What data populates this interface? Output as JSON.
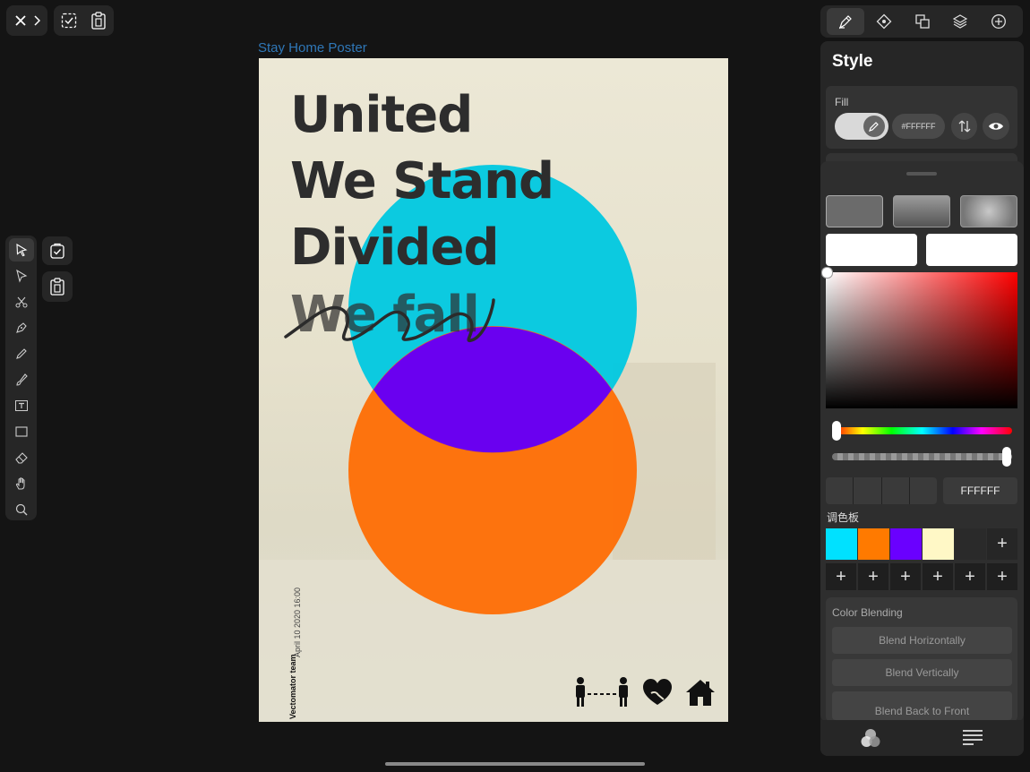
{
  "document": {
    "title": "Stay Home Poster"
  },
  "poster": {
    "lines": [
      "United",
      "We Stand",
      "Divided",
      "We fall"
    ],
    "team": "Vectomator team",
    "date": "April 10 2020 16:00",
    "colors": {
      "background": "#e6e2cf",
      "cyan": "#00c8e0",
      "orange": "#ff6a00",
      "purple": "#6a00f0"
    }
  },
  "top_toolbar": {
    "left_icons": [
      "close-icon",
      "chevron-right-icon",
      "select-all-icon",
      "clipboard-icon"
    ],
    "right_tabs": [
      "style-tab",
      "path-tab",
      "arrange-tab",
      "layers-tab",
      "add-tab"
    ]
  },
  "left_toolbar": {
    "tools": [
      "selection-icon",
      "direct-selection-icon",
      "scissors-icon",
      "pen-icon",
      "pencil-icon",
      "brush-icon",
      "text-icon",
      "rectangle-icon",
      "eraser-icon",
      "hand-icon",
      "zoom-icon"
    ]
  },
  "style_panel": {
    "title": "Style",
    "fill_label": "Fill",
    "fill_hex": "#FFFFFF",
    "hex_value": "FFFFFF",
    "palette_label": "调色板",
    "palette": [
      "#00e1ff",
      "#ff7a00",
      "#6a00ff",
      "#fff8c6",
      "#2a2a2a"
    ],
    "blending_label": "Color Blending",
    "blend_buttons": [
      "Blend Horizontally",
      "Blend Vertically",
      "Blend Back to Front"
    ]
  },
  "bottom_tabs": [
    "color-tab-icon",
    "text-align-icon"
  ]
}
